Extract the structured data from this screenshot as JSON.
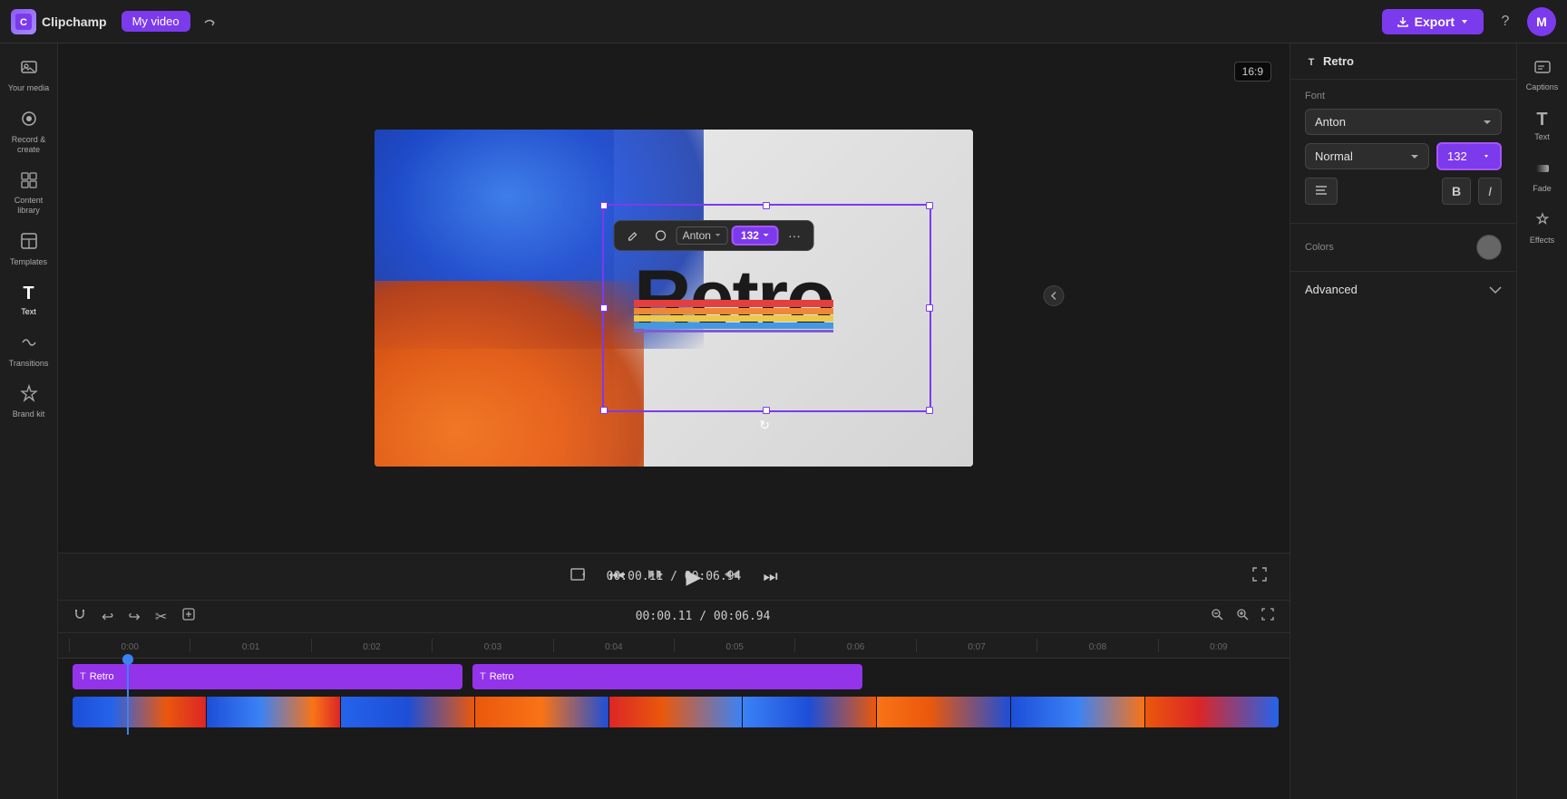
{
  "app": {
    "name": "Clipchamp",
    "logo_text": "C"
  },
  "topbar": {
    "video_name": "My video",
    "export_label": "Export",
    "avatar_initials": "M",
    "help_label": "?"
  },
  "sidebar_left": {
    "items": [
      {
        "id": "your-media",
        "label": "Your media",
        "icon": "⊞"
      },
      {
        "id": "record-create",
        "label": "Record & create",
        "icon": "⬤"
      },
      {
        "id": "content-library",
        "label": "Content library",
        "icon": "🖼"
      },
      {
        "id": "templates",
        "label": "Templates",
        "icon": "⊡"
      },
      {
        "id": "text",
        "label": "Text",
        "icon": "T",
        "active": true
      },
      {
        "id": "transitions",
        "label": "Transitions",
        "icon": "⇄"
      },
      {
        "id": "brand-kit",
        "label": "Brand kit",
        "icon": "◈"
      }
    ]
  },
  "canvas": {
    "aspect_ratio": "16:9",
    "text_overlay": "Retro"
  },
  "text_toolbar": {
    "font_name": "Anton",
    "font_size": "132",
    "more_icon": "···"
  },
  "player": {
    "current_time": "00:00.11",
    "total_time": "00:06.94"
  },
  "timeline": {
    "toolbar_tools": [
      "magnet",
      "undo",
      "redo",
      "cut",
      "sticker"
    ],
    "tracks": [
      {
        "type": "text",
        "label": "Retro",
        "id": "track-text-1"
      },
      {
        "type": "text",
        "label": "Retro",
        "id": "track-text-2"
      }
    ],
    "ruler_marks": [
      "0:00",
      "0:01",
      "0:02",
      "0:03",
      "0:04",
      "0:05",
      "0:06",
      "0:07",
      "0:08",
      "0:09"
    ]
  },
  "properties": {
    "title": "Retro",
    "font": {
      "label": "Font",
      "value": "Anton",
      "style_label": "Normal",
      "size_value": "132"
    },
    "colors": {
      "label": "Colors"
    },
    "advanced": {
      "label": "Advanced"
    }
  },
  "sidebar_right": {
    "items": [
      {
        "id": "captions",
        "label": "Captions",
        "icon": "⊟"
      },
      {
        "id": "text",
        "label": "Text",
        "icon": "T"
      },
      {
        "id": "fade",
        "label": "Fade",
        "icon": "◐"
      },
      {
        "id": "effects",
        "label": "Effects",
        "icon": "✦"
      }
    ]
  }
}
